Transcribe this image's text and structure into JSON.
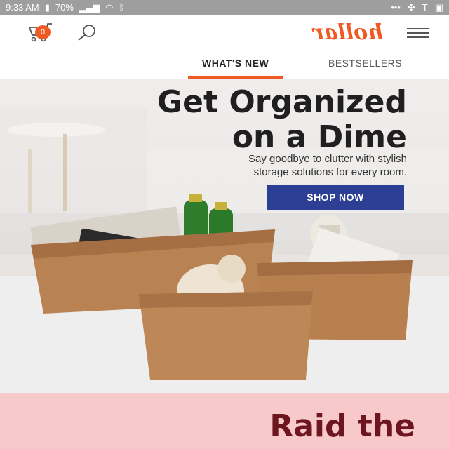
{
  "status_bar": {
    "time": "9:33 AM",
    "battery": "70%",
    "right_letter": "T",
    "icons": [
      "gallery-icon",
      "fan-icon",
      "more-icon",
      "bluetooth-icon",
      "wifi-icon",
      "signal-icon",
      "battery-icon"
    ]
  },
  "header": {
    "cart_count": "0",
    "logo_text": "hollar",
    "brand_color": "#ef5a24"
  },
  "tabs": [
    {
      "label": "WHAT'S NEW",
      "active": true
    },
    {
      "label": "BESTSELLERS",
      "active": false
    }
  ],
  "hero": {
    "title_line1": "Get Organized",
    "title_line2": "on a Dime",
    "subtitle_line1": "Say goodbye to clutter with stylish",
    "subtitle_line2": "storage solutions for every room.",
    "button_label": "SHOP NOW",
    "button_color": "#2d3f94"
  },
  "promo": {
    "title": "Raid the",
    "background": "#f7c9cb",
    "text_color": "#6d1620"
  }
}
